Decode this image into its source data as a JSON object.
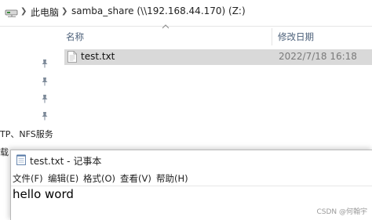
{
  "explorer": {
    "breadcrumb": {
      "computer": "此电脑",
      "share": "samba_share (\\\\192.168.44.170) (Z:)"
    },
    "columns": {
      "name": "名称",
      "date_modified": "修改日期"
    },
    "files": [
      {
        "name": "test.txt",
        "date": "2022/7/18 16:18"
      }
    ],
    "sidebar_partial": {
      "item1": "TP、NFS服务",
      "item2": "载"
    }
  },
  "notepad": {
    "title": "test.txt - 记事本",
    "menu": [
      "文件(F)",
      "编辑(E)",
      "格式(O)",
      "查看(V)",
      "帮助(H)"
    ],
    "content": "hello word"
  },
  "watermark": "CSDN @何翰宇"
}
